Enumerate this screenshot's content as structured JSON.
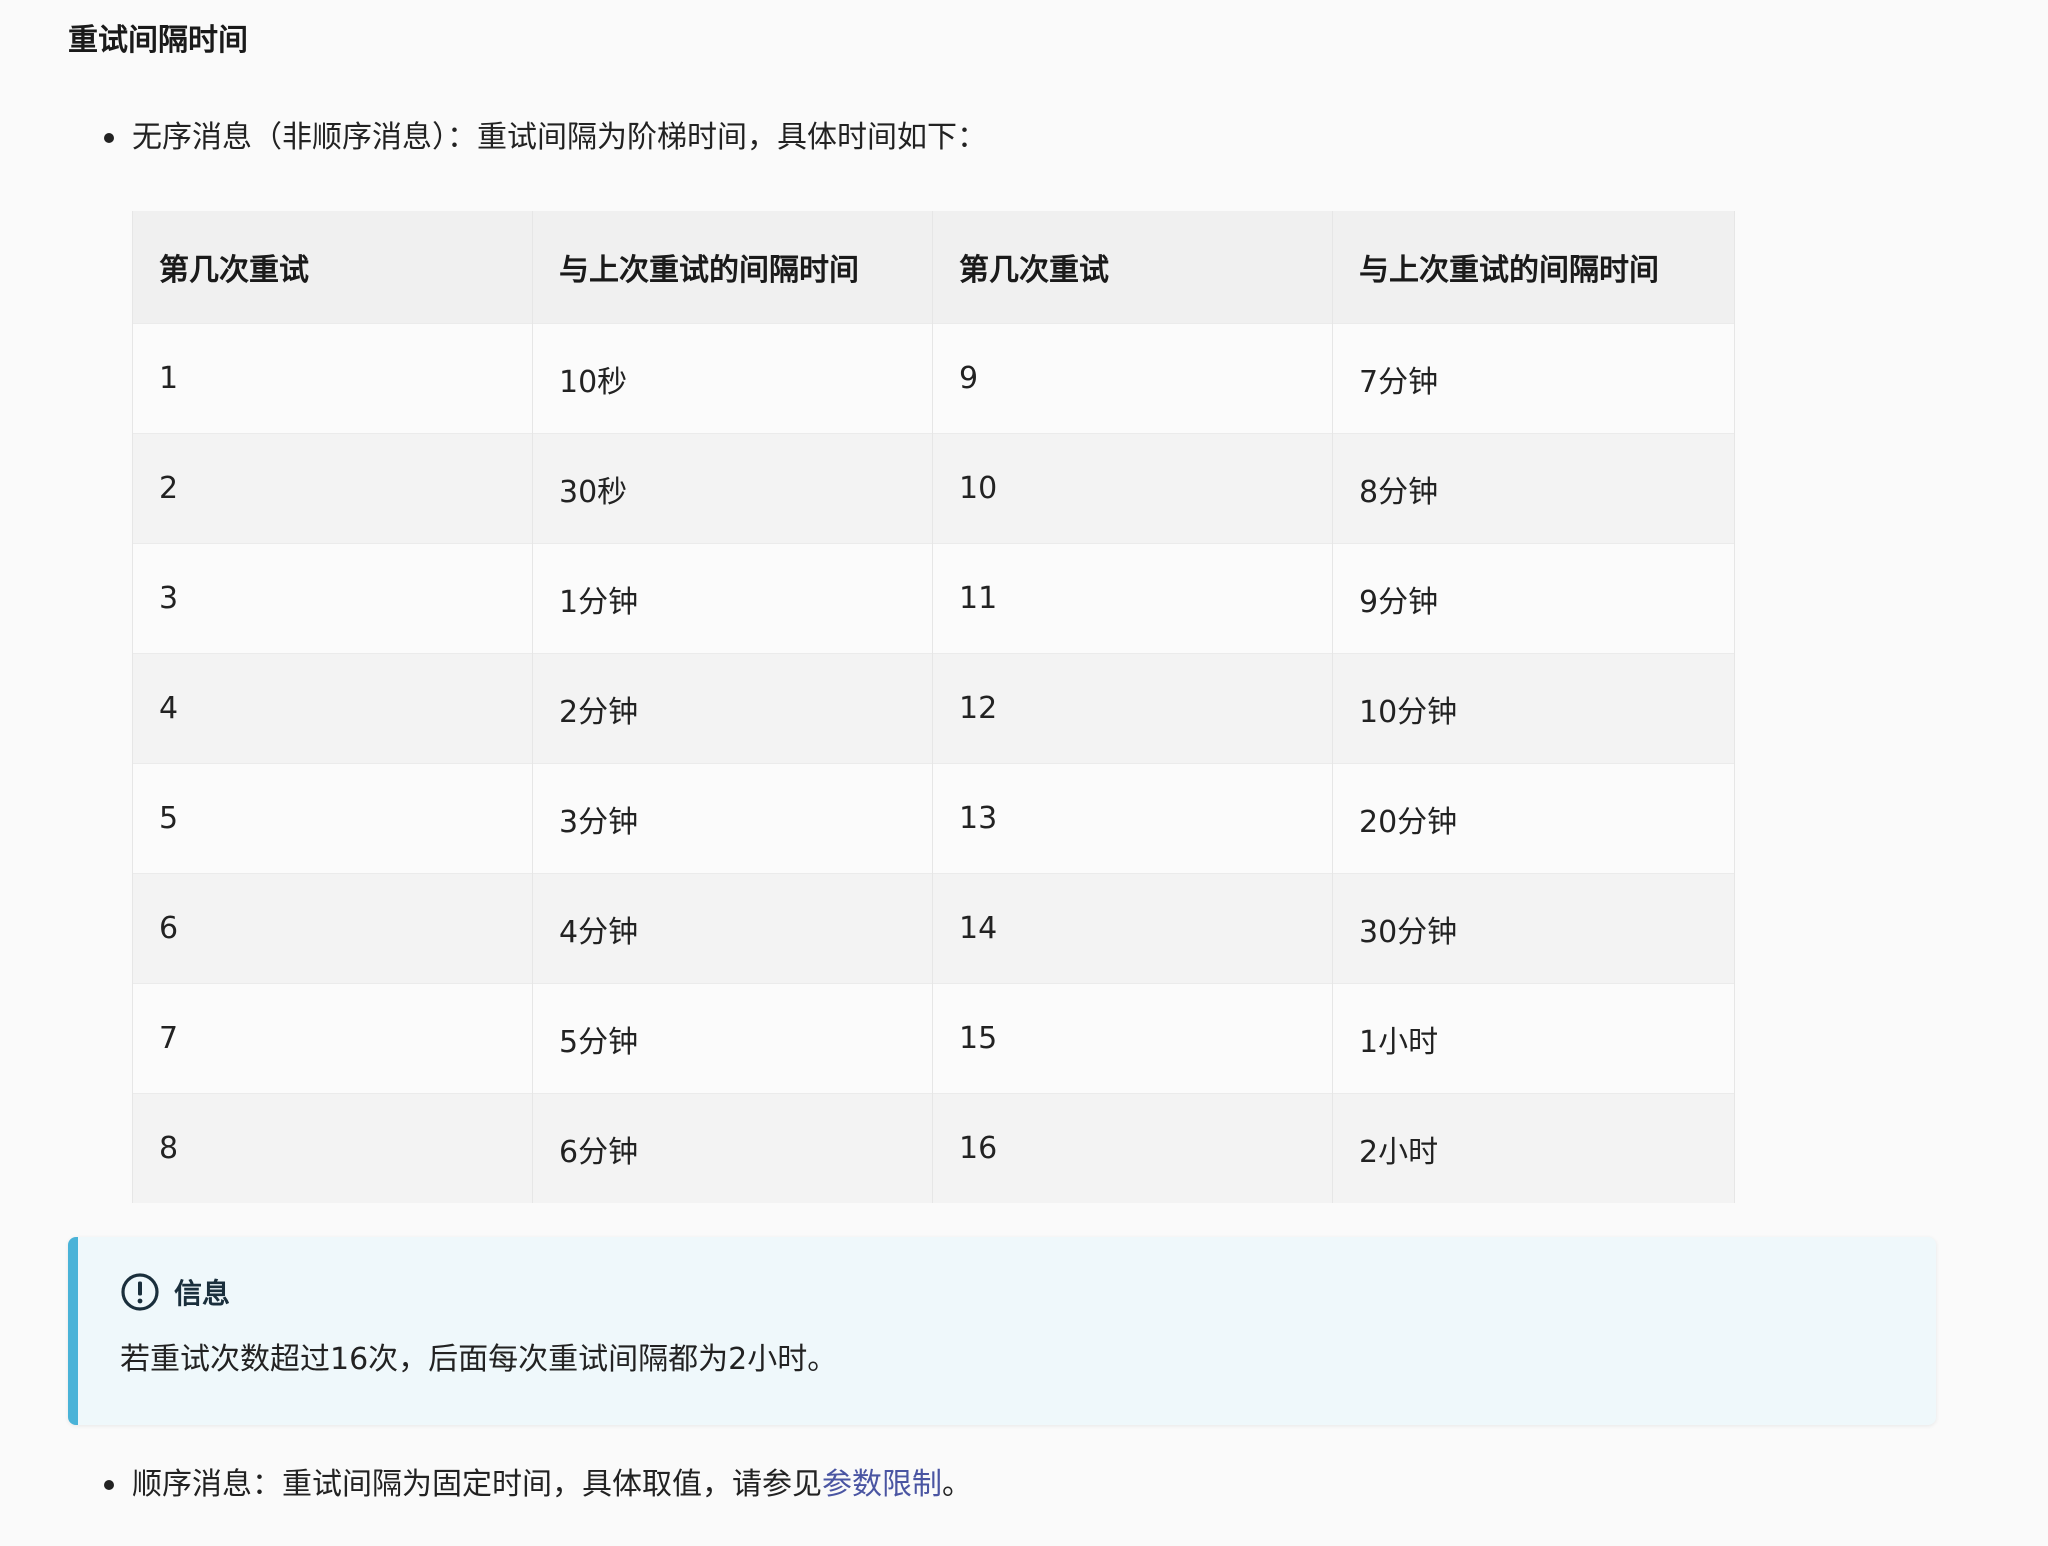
{
  "section": {
    "title": "重试间隔时间"
  },
  "bullet_unordered": {
    "text": "无序消息（非顺序消息）：重试间隔为阶梯时间，具体时间如下："
  },
  "table": {
    "headers": [
      "第几次重试",
      "与上次重试的间隔时间",
      "第几次重试",
      "与上次重试的间隔时间"
    ],
    "rows": [
      [
        "1",
        "10秒",
        "9",
        "7分钟"
      ],
      [
        "2",
        "30秒",
        "10",
        "8分钟"
      ],
      [
        "3",
        "1分钟",
        "11",
        "9分钟"
      ],
      [
        "4",
        "2分钟",
        "12",
        "10分钟"
      ],
      [
        "5",
        "3分钟",
        "13",
        "20分钟"
      ],
      [
        "6",
        "4分钟",
        "14",
        "30分钟"
      ],
      [
        "7",
        "5分钟",
        "15",
        "1小时"
      ],
      [
        "8",
        "6分钟",
        "16",
        "2小时"
      ]
    ]
  },
  "info": {
    "icon": "info-exclamation-icon",
    "title": "信息",
    "text": "若重试次数超过16次，后面每次重试间隔都为2小时。",
    "accent_color": "#4ab3d8"
  },
  "bullet_ordered": {
    "prefix": "顺序消息：重试间隔为固定时间，具体取值，请参见",
    "link_text": "参数限制",
    "suffix": "。",
    "link_color": "#4a55a2"
  }
}
